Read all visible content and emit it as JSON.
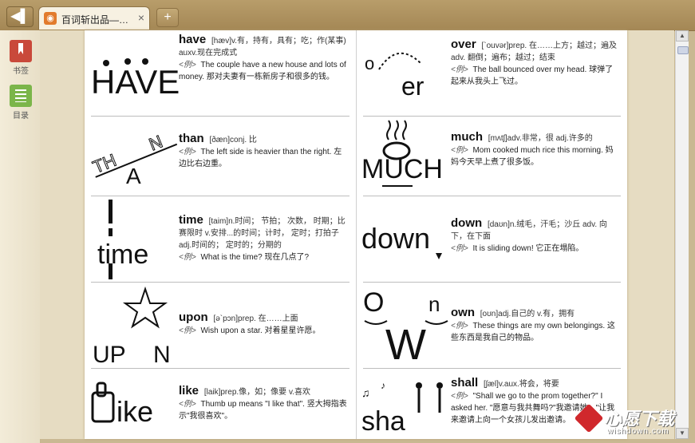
{
  "titlebar": {
    "back_label": "◀▌",
    "tab_title": "百词斩出品—…",
    "tab_close": "×",
    "new_tab": "+"
  },
  "sidebar": {
    "bookmark_label": "书签",
    "toc_label": "目录"
  },
  "scrollbar": {
    "up": "▲",
    "down": "▼"
  },
  "left_entries": [
    {
      "word": "have",
      "def": "[hæv]v.有，持有，具有；吃；作(某事) auxv.现在完成式",
      "example": "The couple have a new house and lots of money. 那对夫妻有一栋新房子和很多的钱。",
      "art": "HAVE"
    },
    {
      "word": "than",
      "def": "[ðæn]conj. 比",
      "example": "The left side is heavier than the right. 左边比右边重。",
      "art": "THAN"
    },
    {
      "word": "time",
      "def": "[taim]n.时间； 节拍； 次数， 时期；比赛限时 v.安排...的时间；计时， 定时；打拍子 adj.时间的； 定时的；分期的",
      "example": "What is the time? 现在几点了?",
      "art": "time"
    },
    {
      "word": "upon",
      "def": "[ə`pɔn]prep. 在……上面",
      "example": "Wish upon a star. 对着星星许愿。",
      "art": "UPON"
    },
    {
      "word": "like",
      "def": "[laik]prep.像，如；像要 v.喜欢",
      "example": "Thumb up means \"I like that\". 竖大拇指表示\"我很喜欢\"。",
      "art": "like"
    }
  ],
  "right_entries": [
    {
      "word": "over",
      "def": "[`ouvər]prep. 在……上方；越过；遍及 adv. 翻倒；遍布；越过；结束",
      "example": "The ball bounced over my head. 球弹了起来从我头上飞过。",
      "art": "over"
    },
    {
      "word": "much",
      "def": "[mʌtʃ]adv.非常，很 adj.许多的",
      "example": "Mom cooked much rice this morning. 妈妈今天早上煮了很多饭。",
      "art": "MUCH"
    },
    {
      "word": "down",
      "def": "[daʊn]n.绒毛，汗毛；沙丘 adv. 向下，在下面",
      "example": "It is sliding down! 它正在塌陷。",
      "art": "down"
    },
    {
      "word": "own",
      "def": "[oʊn]adj.自己的 v.有，拥有",
      "example": "These things are my own belongings. 这些东西是我自己的物品。",
      "art": "OWN"
    },
    {
      "word": "shall",
      "def": "[ʃæl]v.aux.将会，将要",
      "example": "\"Shall we go to the prom together?\" I asked her. \"愿意与我共舞吗?\"我邀请她。\"让我来邀请上向一个女孩儿发出邀请。",
      "art": "shall"
    }
  ],
  "example_tag": "<例>",
  "watermark": {
    "main": "心愿下载",
    "sub": "wishdown.com"
  }
}
